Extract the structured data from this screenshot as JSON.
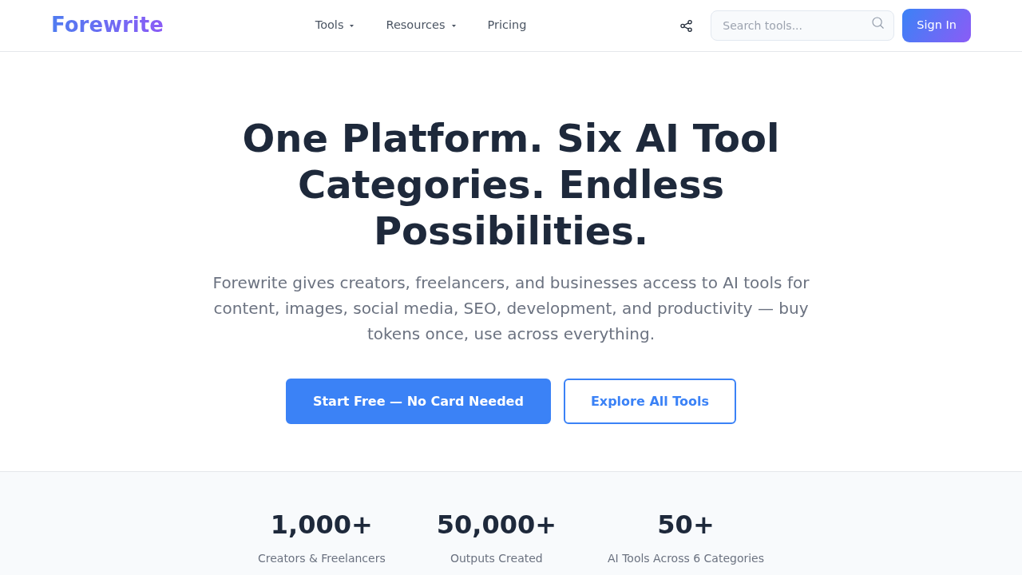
{
  "navbar": {
    "logo": "Forewrite",
    "links": [
      {
        "label": "Tools",
        "dropdown": true
      },
      {
        "label": "Resources",
        "dropdown": true
      },
      {
        "label": "Pricing",
        "dropdown": false
      }
    ],
    "search": {
      "placeholder": "Search tools..."
    },
    "sign_in": "Sign In"
  },
  "hero": {
    "title": "One Platform. Six AI Tool Categories. Endless Possibilities.",
    "subtitle": "Forewrite gives creators, freelancers, and businesses access to AI tools for content, images, social media, SEO, development, and productivity — buy tokens once, use across everything.",
    "buttons": [
      {
        "label": "Start Free — No Card Needed",
        "kind": "primary"
      },
      {
        "label": "Explore All Tools",
        "kind": "outline"
      }
    ]
  },
  "stats": [
    {
      "value": "1,000+",
      "label": "Creators & Freelancers"
    },
    {
      "value": "50,000+",
      "label": "Outputs Created"
    },
    {
      "value": "50+",
      "label": "AI Tools Across 6 Categories"
    }
  ]
}
